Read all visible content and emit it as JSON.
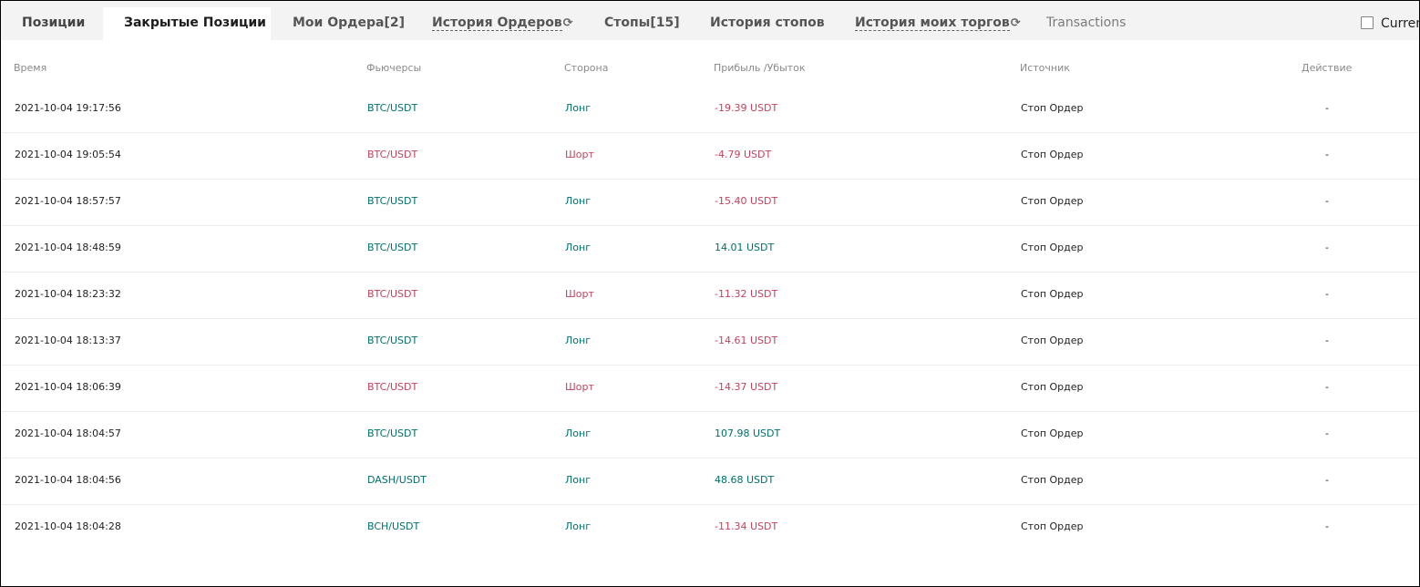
{
  "tabs": [
    {
      "label": "Позиции",
      "suffix": "",
      "refresh": false,
      "style": "dark"
    },
    {
      "label": "Закрытые Позиции",
      "suffix": "",
      "refresh": false,
      "style": "bold-active"
    },
    {
      "label": "Мои Ордера",
      "suffix": "[2]",
      "refresh": false,
      "style": "normal"
    },
    {
      "label": "История Ордеров",
      "suffix": "",
      "refresh": true,
      "style": "dashed"
    },
    {
      "label": "Стопы",
      "suffix": "[15]",
      "refresh": false,
      "style": "normal"
    },
    {
      "label": "История стопов",
      "suffix": "",
      "refresh": false,
      "style": "normal"
    },
    {
      "label": "История моих торгов",
      "suffix": "",
      "refresh": true,
      "style": "dashed"
    },
    {
      "label": "Transactions",
      "suffix": "",
      "refresh": false,
      "style": "light"
    }
  ],
  "current_label": "Curren",
  "columns": {
    "time": "Время",
    "futures": "Фьючерсы",
    "side": "Сторона",
    "pnl": "Прибыль /Убыток",
    "source": "Источник",
    "action": "Действие"
  },
  "colors": {
    "positive": "#00706b",
    "negative": "#c4425c"
  },
  "rows": [
    {
      "time": "2021-10-04 19:17:56",
      "futures": "BTC/USDT",
      "side": "Лонг",
      "pnl": "-19.39 USDT",
      "source": "Стоп Ордер",
      "action": "-",
      "side_type": "long",
      "pnl_type": "neg"
    },
    {
      "time": "2021-10-04 19:05:54",
      "futures": "BTC/USDT",
      "side": "Шорт",
      "pnl": "-4.79 USDT",
      "source": "Стоп Ордер",
      "action": "-",
      "side_type": "short",
      "pnl_type": "neg"
    },
    {
      "time": "2021-10-04 18:57:57",
      "futures": "BTC/USDT",
      "side": "Лонг",
      "pnl": "-15.40 USDT",
      "source": "Стоп Ордер",
      "action": "-",
      "side_type": "long",
      "pnl_type": "neg"
    },
    {
      "time": "2021-10-04 18:48:59",
      "futures": "BTC/USDT",
      "side": "Лонг",
      "pnl": "14.01 USDT",
      "source": "Стоп Ордер",
      "action": "-",
      "side_type": "long",
      "pnl_type": "pos"
    },
    {
      "time": "2021-10-04 18:23:32",
      "futures": "BTC/USDT",
      "side": "Шорт",
      "pnl": "-11.32 USDT",
      "source": "Стоп Ордер",
      "action": "-",
      "side_type": "short",
      "pnl_type": "neg"
    },
    {
      "time": "2021-10-04 18:13:37",
      "futures": "BTC/USDT",
      "side": "Лонг",
      "pnl": "-14.61 USDT",
      "source": "Стоп Ордер",
      "action": "-",
      "side_type": "long",
      "pnl_type": "neg"
    },
    {
      "time": "2021-10-04 18:06:39",
      "futures": "BTC/USDT",
      "side": "Шорт",
      "pnl": "-14.37 USDT",
      "source": "Стоп Ордер",
      "action": "-",
      "side_type": "short",
      "pnl_type": "neg"
    },
    {
      "time": "2021-10-04 18:04:57",
      "futures": "BTC/USDT",
      "side": "Лонг",
      "pnl": "107.98 USDT",
      "source": "Стоп Ордер",
      "action": "-",
      "side_type": "long",
      "pnl_type": "pos"
    },
    {
      "time": "2021-10-04 18:04:56",
      "futures": "DASH/USDT",
      "side": "Лонг",
      "pnl": "48.68 USDT",
      "source": "Стоп Ордер",
      "action": "-",
      "side_type": "long",
      "pnl_type": "pos"
    },
    {
      "time": "2021-10-04 18:04:28",
      "futures": "BCH/USDT",
      "side": "Лонг",
      "pnl": "-11.34 USDT",
      "source": "Стоп Ордер",
      "action": "-",
      "side_type": "long",
      "pnl_type": "neg"
    }
  ]
}
